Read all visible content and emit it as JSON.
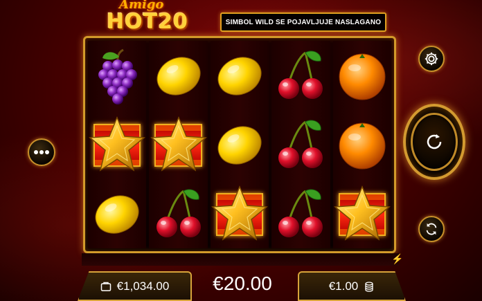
{
  "logo": {
    "line1": "Amigo",
    "line2": "HOT20"
  },
  "message": "SIMBOL WILD SE POJAVLJUJE NASLAGANO",
  "reels": [
    [
      "grapes",
      "wild-star",
      "lemon"
    ],
    [
      "lemon",
      "wild-star",
      "cherries"
    ],
    [
      "lemon",
      "lemon",
      "wild-star"
    ],
    [
      "cherries",
      "cherries",
      "cherries"
    ],
    [
      "orange",
      "orange",
      "wild-star"
    ]
  ],
  "buttons": {
    "menu": "ellipsis-icon",
    "settings": "gear-icon",
    "spin": "spin-arrow-icon",
    "autoplay": "autoplay-icon"
  },
  "balance": {
    "icon": "wallet-icon",
    "value": "€1,034.00"
  },
  "bet": {
    "value": "€20.00"
  },
  "coin": {
    "value": "€1.00",
    "icon": "coin-stack-icon"
  },
  "turbo_icon": "lightning-icon",
  "colors": {
    "gold": "#d8a43a",
    "red_bg": "#5a0000",
    "accent": "#ffd23a"
  }
}
